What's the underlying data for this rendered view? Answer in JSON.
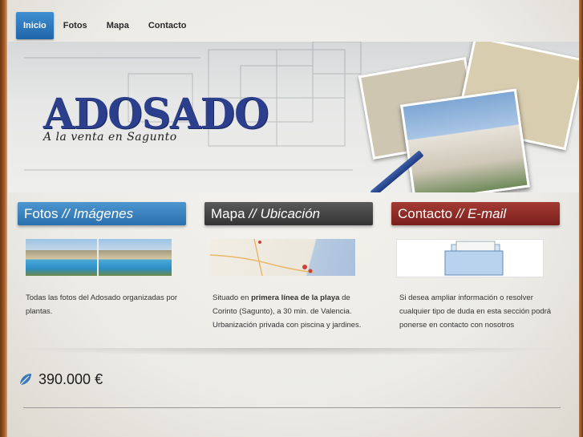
{
  "nav": {
    "items": [
      {
        "label": "Inicio",
        "active": true
      },
      {
        "label": "Fotos",
        "active": false
      },
      {
        "label": "Mapa",
        "active": false
      },
      {
        "label": "Contacto",
        "active": false
      }
    ]
  },
  "banner": {
    "title": "ADOSADO",
    "subtitle": "A la venta en Sagunto"
  },
  "columns": [
    {
      "heading_plain": "Fotos",
      "heading_italic": "Imágenes",
      "color": "#2a6fae",
      "text": "Todas las fotos del Adosado organizadas por plantas."
    },
    {
      "heading_plain": "Mapa",
      "heading_italic": "Ubicación",
      "color": "#333333",
      "text_before": "Situado en ",
      "text_bold": "primera línea de la playa",
      "text_after": " de Corinto (Sagunto), a 30 min. de Valencia. Urbanización privada con piscina y jardines."
    },
    {
      "heading_plain": "Contacto",
      "heading_italic": "E-mail",
      "color": "#7a1f1b",
      "text": "Si desea ampliar información o resolver cualquier tipo de duda en esta sección podrá ponerse en contacto con nosotros"
    }
  ],
  "price": {
    "value": "390.000 €",
    "icon": "leaf-icon"
  },
  "heading_separator": "//"
}
